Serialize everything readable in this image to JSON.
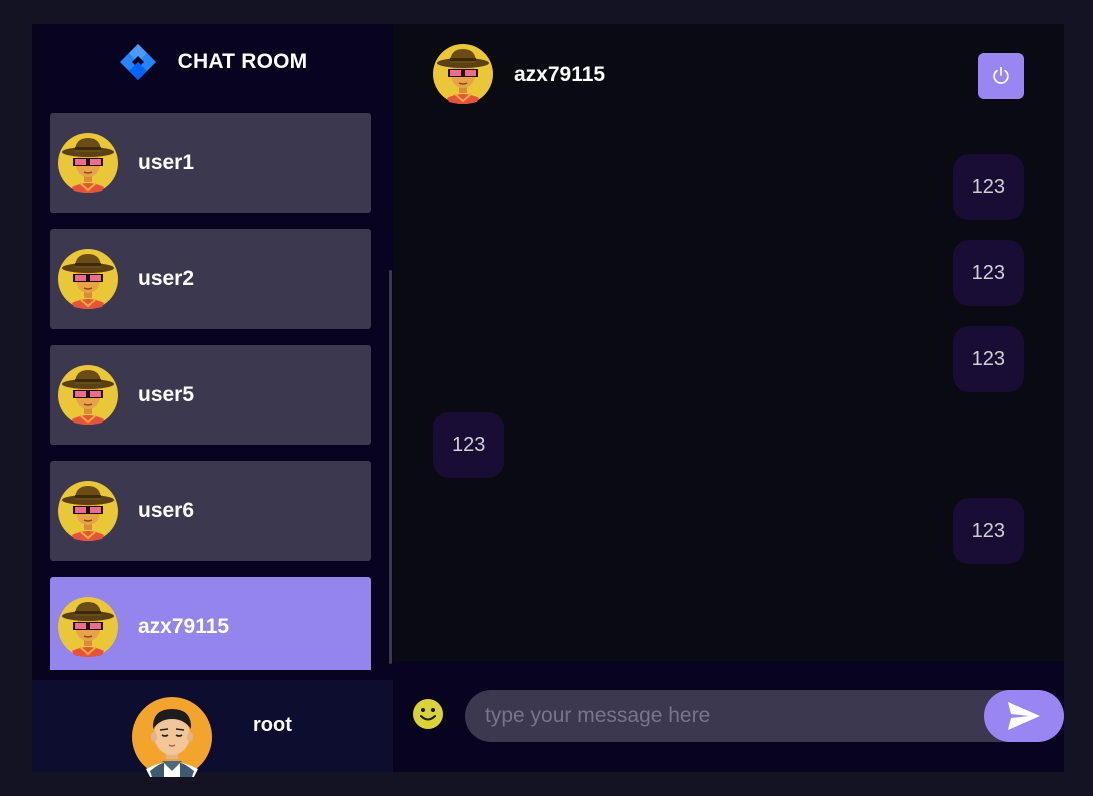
{
  "brand": {
    "title": "CHAT ROOM",
    "logo": "diamond-logo-icon"
  },
  "contacts": [
    {
      "name": "user1",
      "avatar": "cowboy-avatar",
      "selected": false
    },
    {
      "name": "user2",
      "avatar": "cowboy-avatar",
      "selected": false
    },
    {
      "name": "user5",
      "avatar": "cowboy-avatar",
      "selected": false
    },
    {
      "name": "user6",
      "avatar": "cowboy-avatar",
      "selected": false
    },
    {
      "name": "azx79115",
      "avatar": "cowboy-avatar",
      "selected": true
    }
  ],
  "current_user": {
    "name": "root",
    "avatar": "boy-avatar"
  },
  "chat": {
    "header_name": "azx79115",
    "logout_icon": "power-icon",
    "messages": [
      {
        "text": "123",
        "direction": "sended"
      },
      {
        "text": "123",
        "direction": "sended"
      },
      {
        "text": "123",
        "direction": "sended"
      },
      {
        "text": "123",
        "direction": "recieved"
      },
      {
        "text": "123",
        "direction": "sended"
      }
    ],
    "input_placeholder": "type your message here",
    "emoji_icon": "smiley-icon",
    "send_icon": "send-icon"
  },
  "colors": {
    "accent": "#9a86f3",
    "selected_contact": "#9385ec",
    "contact_bg": "#3c3850",
    "bubble_bg": "#1a0d35"
  }
}
